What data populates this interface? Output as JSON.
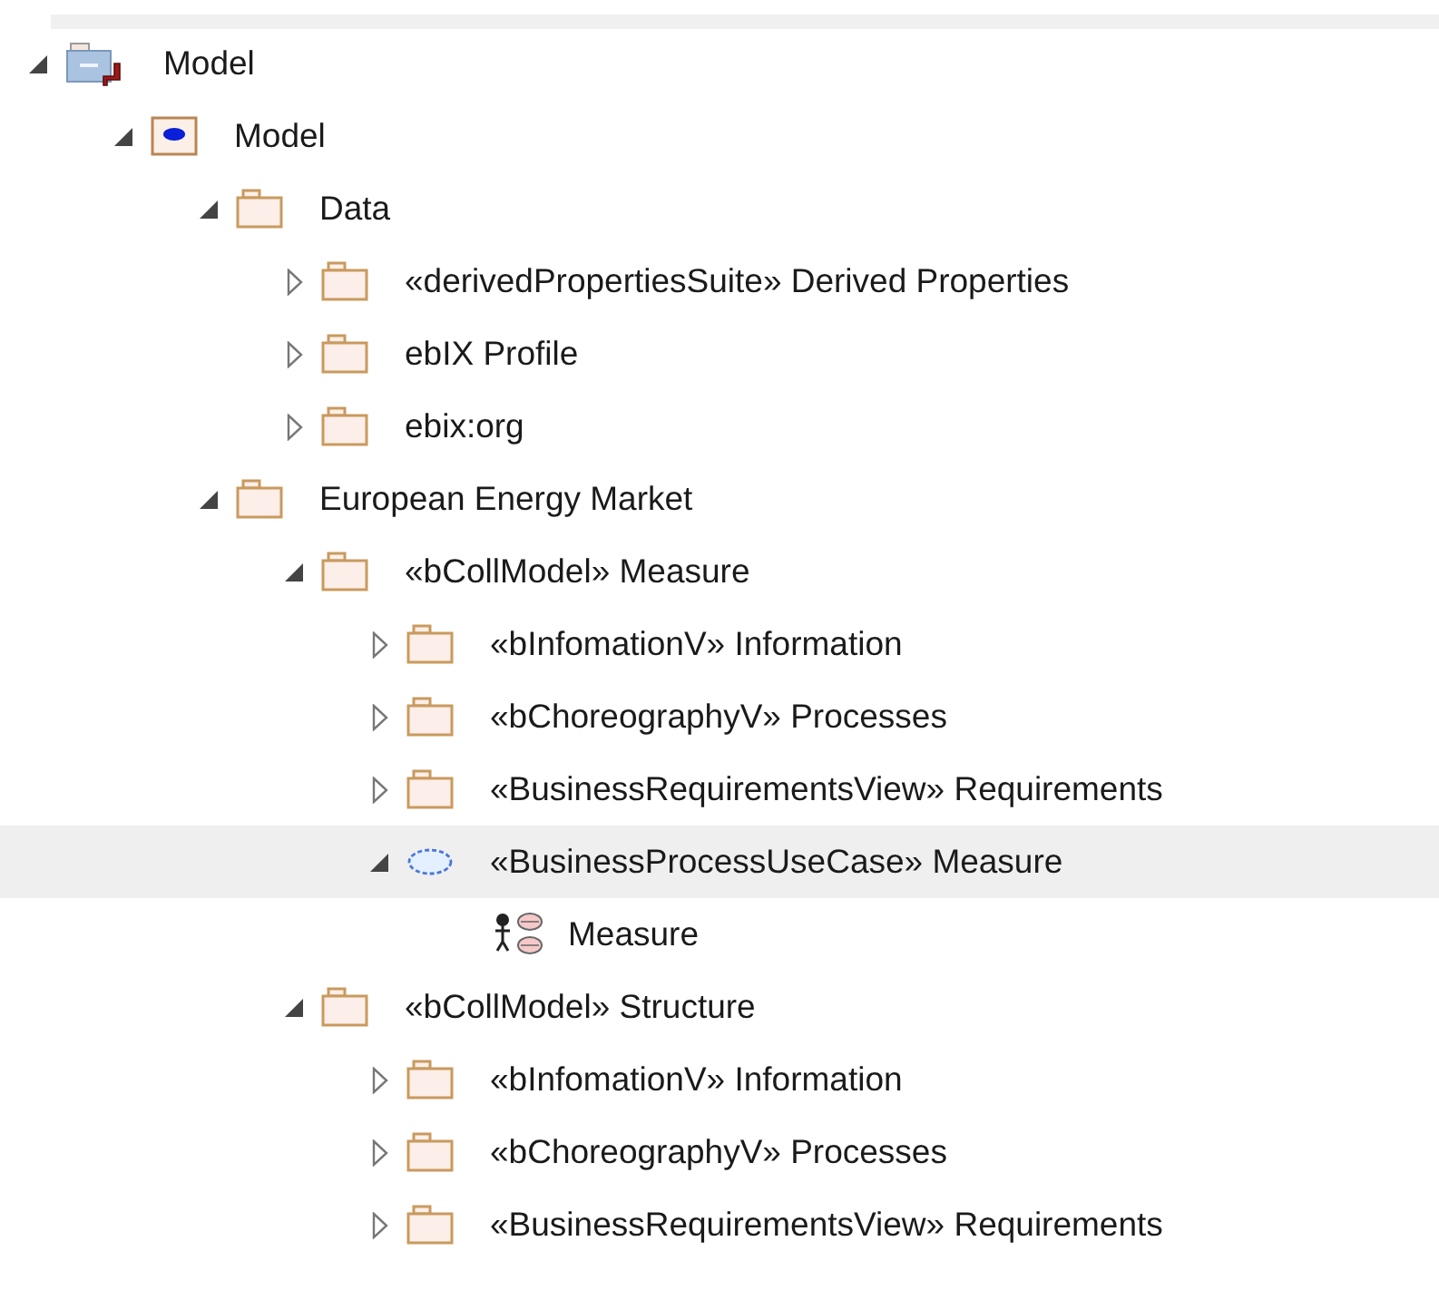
{
  "tree": {
    "items": [
      {
        "label": "Model",
        "kind": "root",
        "expanded": true,
        "selected": false,
        "children": [
          {
            "label": "Model",
            "kind": "model",
            "expanded": true,
            "selected": false,
            "children": [
              {
                "label": "Data",
                "kind": "folder",
                "expanded": true,
                "selected": false,
                "children": [
                  {
                    "label": "«derivedPropertiesSuite» Derived Properties",
                    "kind": "folder",
                    "expanded": false,
                    "selected": false
                  },
                  {
                    "label": "ebIX Profile",
                    "kind": "folder",
                    "expanded": false,
                    "selected": false
                  },
                  {
                    "label": "ebix:org",
                    "kind": "folder",
                    "expanded": false,
                    "selected": false
                  }
                ]
              },
              {
                "label": "European Energy Market",
                "kind": "folder",
                "expanded": true,
                "selected": false,
                "children": [
                  {
                    "label": "«bCollModel» Measure",
                    "kind": "folder",
                    "expanded": true,
                    "selected": false,
                    "children": [
                      {
                        "label": "«bInfomationV» Information",
                        "kind": "folder",
                        "expanded": false,
                        "selected": false
                      },
                      {
                        "label": "«bChoreographyV» Processes",
                        "kind": "folder",
                        "expanded": false,
                        "selected": false
                      },
                      {
                        "label": "«BusinessRequirementsView» Requirements",
                        "kind": "folder",
                        "expanded": false,
                        "selected": false
                      },
                      {
                        "label": "«BusinessProcessUseCase» Measure",
                        "kind": "usecase",
                        "expanded": true,
                        "selected": true,
                        "children": [
                          {
                            "label": "Measure",
                            "kind": "actor-usecase",
                            "selected": false
                          }
                        ]
                      }
                    ]
                  },
                  {
                    "label": "«bCollModel» Structure",
                    "kind": "folder",
                    "expanded": true,
                    "selected": false,
                    "children": [
                      {
                        "label": "«bInfomationV» Information",
                        "kind": "folder",
                        "expanded": false,
                        "selected": false
                      },
                      {
                        "label": "«bChoreographyV» Processes",
                        "kind": "folder",
                        "expanded": false,
                        "selected": false
                      },
                      {
                        "label": "«BusinessRequirementsView» Requirements",
                        "kind": "folder",
                        "expanded": false,
                        "selected": false
                      }
                    ]
                  }
                ]
              }
            ]
          }
        ]
      }
    ]
  }
}
